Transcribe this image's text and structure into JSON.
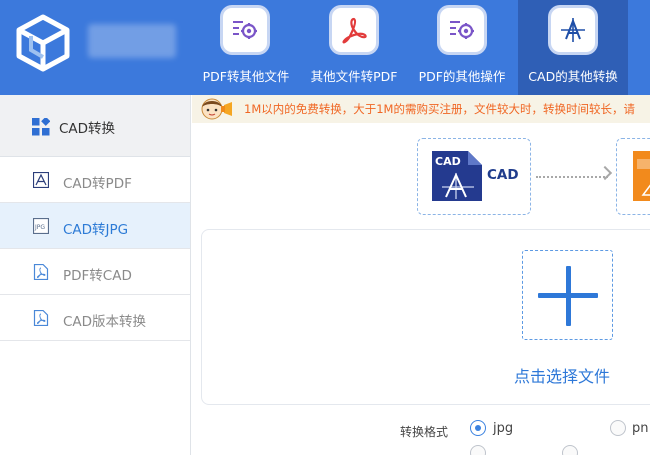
{
  "nav": {
    "items": [
      {
        "label": "PDF转其他文件",
        "icon": "gear-doc-icon"
      },
      {
        "label": "其他文件转PDF",
        "icon": "pdf-icon"
      },
      {
        "label": "PDF的其他操作",
        "icon": "gear-doc-icon"
      },
      {
        "label": "CAD的其他转换",
        "icon": "cad-icon"
      }
    ],
    "active_index": 3,
    "accent": "#3c79dc"
  },
  "sidebar": {
    "header": "CAD转换",
    "items": [
      {
        "label": "CAD转PDF",
        "icon": "cad-file-icon"
      },
      {
        "label": "CAD转JPG",
        "icon": "jpg-file-icon"
      },
      {
        "label": "PDF转CAD",
        "icon": "pdf-file-icon"
      },
      {
        "label": "CAD版本转换",
        "icon": "pdf-file-icon"
      }
    ],
    "active_index": 1
  },
  "notice": {
    "text": "1M以内的免费转换，大于1M的需购买注册，文件较大时，转换时间较长，请"
  },
  "conversion": {
    "source_label": "CAD",
    "source_badge": "CAD"
  },
  "upload": {
    "label": "点击选择文件"
  },
  "format": {
    "label": "转换格式",
    "options": [
      {
        "label": "jpg",
        "selected": true
      },
      {
        "label": "pn",
        "selected": false
      }
    ]
  }
}
